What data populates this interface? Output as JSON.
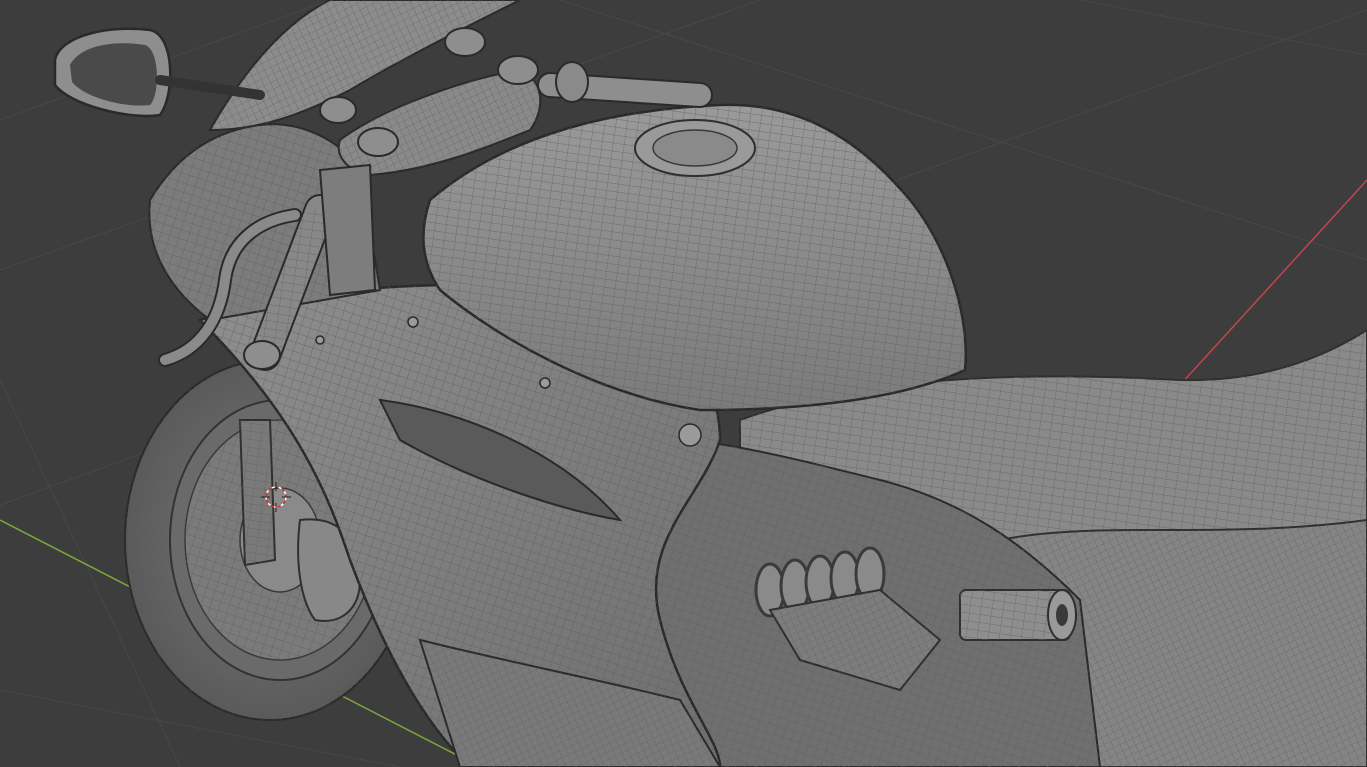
{
  "viewport": {
    "mode": "3D viewport",
    "background_color": "#3d3d3d",
    "grid_color": "#484848",
    "x_axis_color": "#c0464c",
    "y_axis_color": "#7ea83a",
    "mesh_base_color": "#8c8c8c",
    "mesh_wire_color": "#5a5a5a",
    "mesh_dark_color": "#2f2f2f",
    "cursor_color": "#d23232",
    "object": "motorcycle-wireframe-mesh"
  }
}
